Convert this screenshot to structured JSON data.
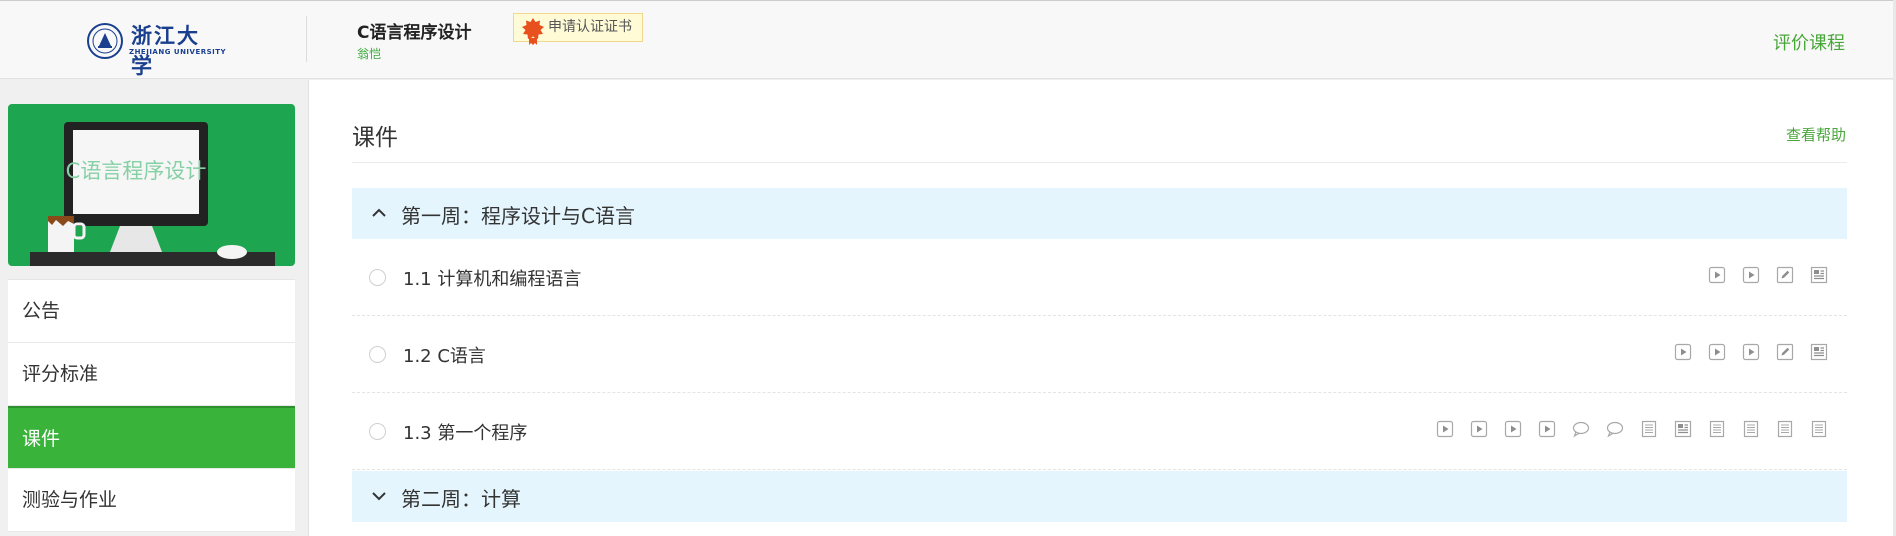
{
  "header": {
    "university_name": "浙江大学",
    "university_name_en": "ZHEJIANG UNIVERSITY",
    "course_name": "C语言程序设计",
    "teacher": "翁恺",
    "certificate_label": "申请认证证书",
    "rate_course": "评价课程"
  },
  "sidebar": {
    "cover_text": "C语言程序设计",
    "menu": [
      {
        "label": "公告",
        "active": false
      },
      {
        "label": "评分标准",
        "active": false
      },
      {
        "label": "课件",
        "active": true
      },
      {
        "label": "测验与作业",
        "active": false
      }
    ]
  },
  "main": {
    "title": "课件",
    "help_link": "查看帮助",
    "chapters": [
      {
        "title": "第一周：程序设计与C语言",
        "expanded": true,
        "lessons": [
          {
            "title": "1.1 计算机和编程语言",
            "icons": [
              "video-icon",
              "video-icon",
              "pencil-icon",
              "document-icon"
            ]
          },
          {
            "title": "1.2 C语言",
            "icons": [
              "video-icon",
              "video-icon",
              "video-icon",
              "pencil-icon",
              "document-icon"
            ]
          },
          {
            "title": "1.3 第一个程序",
            "icons": [
              "video-icon",
              "video-icon",
              "video-icon",
              "video-icon",
              "discussion-icon",
              "discussion-icon",
              "text-icon",
              "document-icon",
              "text-icon",
              "text-icon",
              "text-icon",
              "text-icon"
            ]
          }
        ]
      },
      {
        "title": "第二周：计算",
        "expanded": false,
        "lessons": []
      }
    ]
  },
  "colors": {
    "accent_green": "#3ab33a",
    "link_green": "#49a63a",
    "chapter_bg": "#e5f5fd",
    "cover_green": "#1ea550",
    "university_blue": "#1a3f8f"
  }
}
